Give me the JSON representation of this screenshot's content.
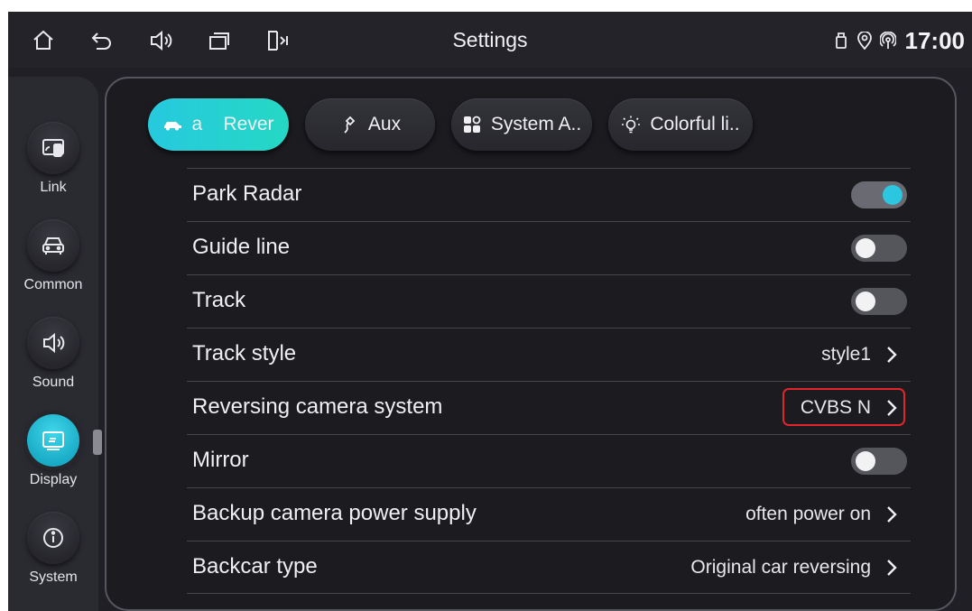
{
  "statusbar": {
    "title": "Settings",
    "time": "17:00",
    "left_icons": [
      "home-icon",
      "back-icon",
      "volume-icon",
      "recent-apps-icon",
      "split-screen-icon"
    ],
    "right_icons": [
      "usb-icon",
      "location-icon",
      "hotspot-icon"
    ]
  },
  "sidebar": {
    "items": [
      {
        "label": "Link",
        "icon": "phone-link-icon"
      },
      {
        "label": "Common",
        "icon": "car-icon"
      },
      {
        "label": "Sound",
        "icon": "speaker-icon"
      },
      {
        "label": "Display",
        "icon": "display-icon",
        "active": true
      },
      {
        "label": "System",
        "icon": "info-icon"
      }
    ]
  },
  "tabs": [
    {
      "label": "a    Rever",
      "icon": "car-reverse-icon",
      "active": true
    },
    {
      "label": "Aux",
      "icon": "aux-cable-icon"
    },
    {
      "label": "System A..",
      "icon": "apps-grid-icon"
    },
    {
      "label": "Colorful li..",
      "icon": "light-bulb-icon"
    }
  ],
  "rows": [
    {
      "label": "Park Radar",
      "type": "toggle",
      "on": true
    },
    {
      "label": "Guide line",
      "type": "toggle",
      "on": false
    },
    {
      "label": "Track",
      "type": "toggle",
      "on": false
    },
    {
      "label": "Track style",
      "type": "select",
      "value": "style1"
    },
    {
      "label": "Reversing camera system",
      "type": "select",
      "value": "CVBS N",
      "highlighted": true
    },
    {
      "label": "Mirror",
      "type": "toggle",
      "on": false
    },
    {
      "label": "Backup camera power supply",
      "type": "select",
      "value": "often power on"
    },
    {
      "label": "Backcar type",
      "type": "select",
      "value": "Original car reversing"
    }
  ],
  "colors": {
    "accent": "#26c9de",
    "background": "#1f1f25",
    "highlight": "#e0262c"
  }
}
